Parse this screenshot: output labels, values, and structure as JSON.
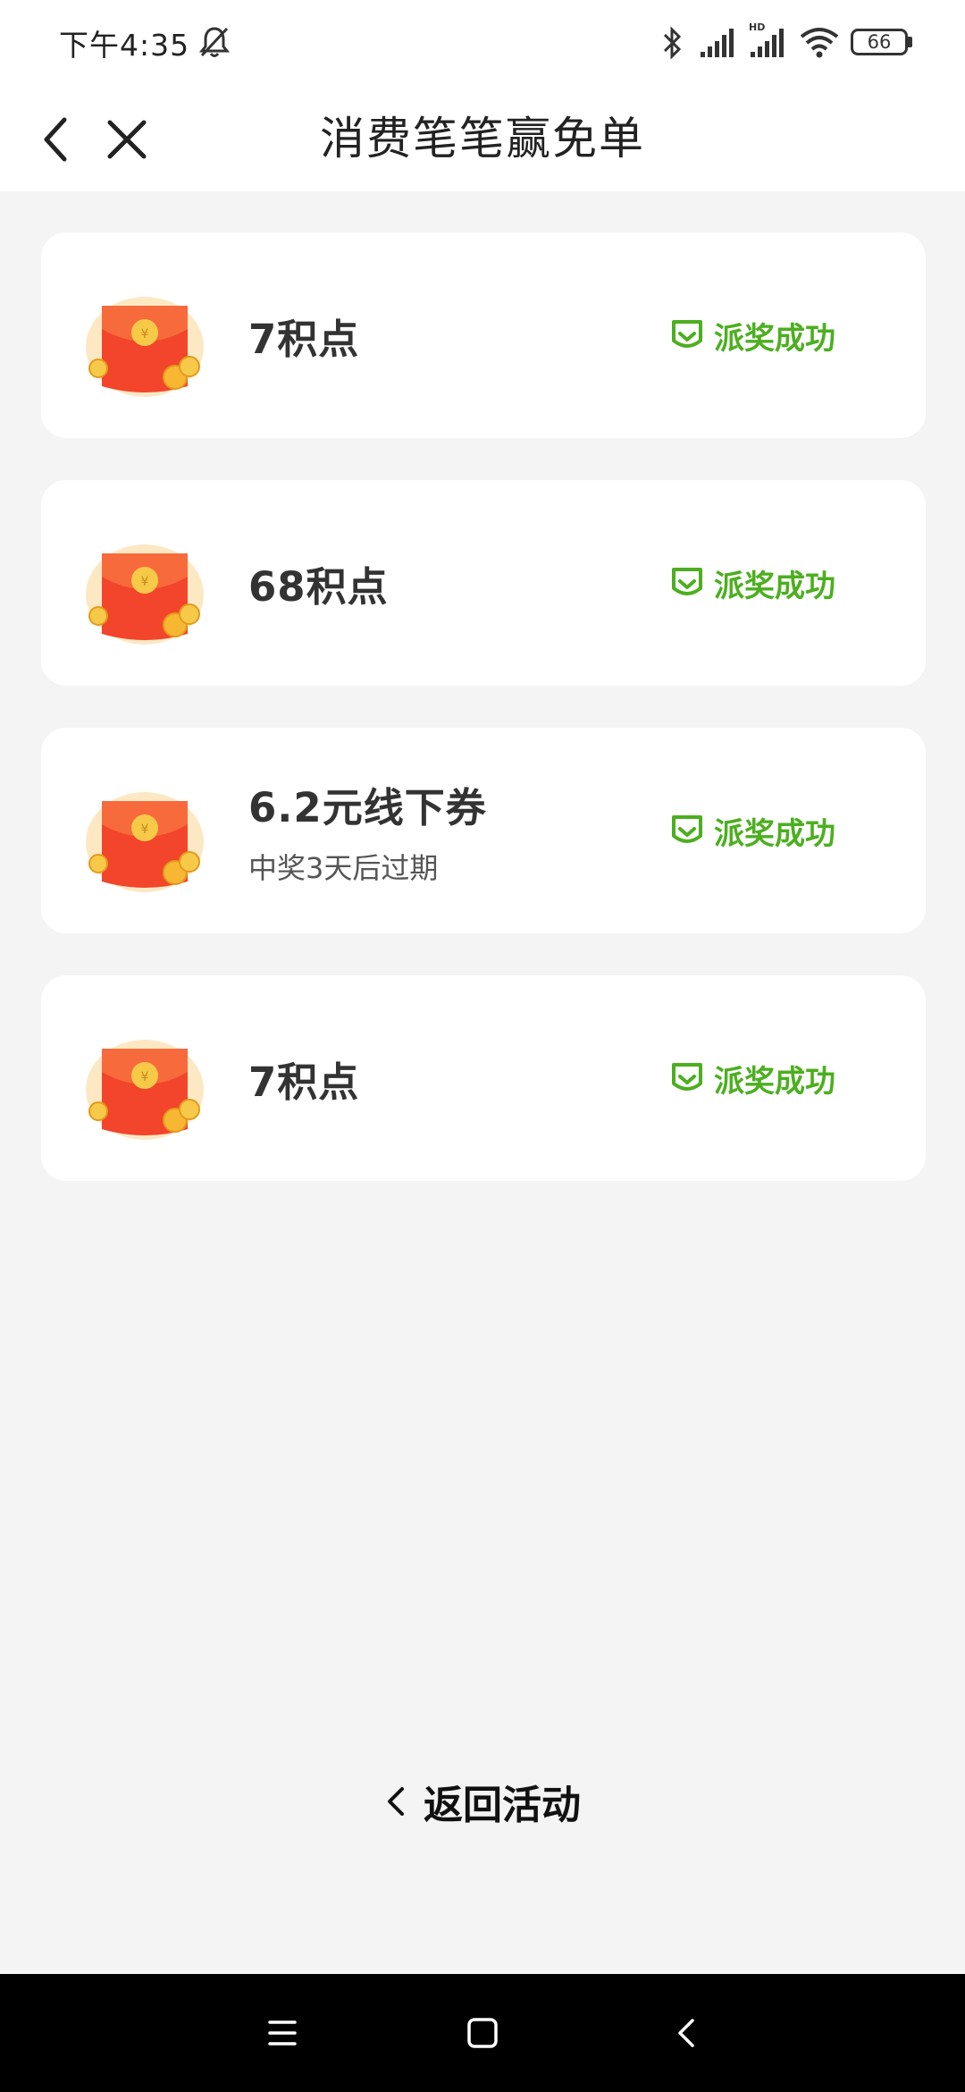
{
  "status_bar": {
    "time": "下午4:35",
    "battery": "66"
  },
  "header": {
    "title": "消费笔笔赢免单"
  },
  "colors": {
    "accent_green": "#4caf1f",
    "background": "#f4f4f4",
    "card": "#ffffff",
    "red_packet": "#f2452b",
    "coin": "#f7b733"
  },
  "rewards": [
    {
      "title": "7积点",
      "subtitle": "",
      "status": "派奖成功"
    },
    {
      "title": "68积点",
      "subtitle": "",
      "status": "派奖成功"
    },
    {
      "title": "6.2元线下券",
      "subtitle": "中奖3天后过期",
      "status": "派奖成功"
    },
    {
      "title": "7积点",
      "subtitle": "",
      "status": "派奖成功"
    }
  ],
  "footer": {
    "return_label": "返回活动"
  }
}
